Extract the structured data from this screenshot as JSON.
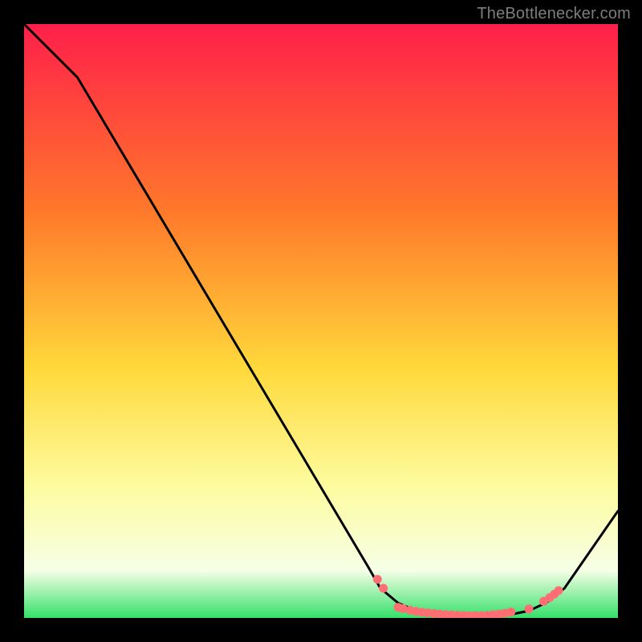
{
  "attribution": "TheBottlenecker.com",
  "colors": {
    "bg_black": "#000000",
    "grad_top": "#ff1f4a",
    "grad_mid1": "#ff7a2a",
    "grad_mid2": "#ffd93b",
    "grad_mid3": "#fdfca0",
    "grad_low": "#f6ffe6",
    "grad_green": "#34e06a",
    "curve": "#000000",
    "marker_fill": "#ff6e72",
    "marker_stroke": "#ff6e72",
    "attr_text": "#7d7d7d"
  },
  "chart_data": {
    "type": "line",
    "title": "",
    "xlabel": "",
    "ylabel": "",
    "xlim": [
      0,
      100
    ],
    "ylim": [
      0,
      100
    ],
    "curve": [
      {
        "x": 0,
        "y": 100
      },
      {
        "x": 9,
        "y": 91
      },
      {
        "x": 58,
        "y": 8.5
      },
      {
        "x": 60,
        "y": 5
      },
      {
        "x": 63,
        "y": 2.5
      },
      {
        "x": 66,
        "y": 1.2
      },
      {
        "x": 70,
        "y": 0.5
      },
      {
        "x": 76,
        "y": 0.3
      },
      {
        "x": 82,
        "y": 0.6
      },
      {
        "x": 85,
        "y": 1.2
      },
      {
        "x": 88,
        "y": 2.6
      },
      {
        "x": 91,
        "y": 5
      },
      {
        "x": 100,
        "y": 18
      }
    ],
    "markers": [
      {
        "x": 59.5,
        "y": 6.5
      },
      {
        "x": 60.5,
        "y": 5.0
      },
      {
        "x": 63.0,
        "y": 1.8
      },
      {
        "x": 63.8,
        "y": 1.6
      },
      {
        "x": 65.0,
        "y": 1.3
      },
      {
        "x": 66.0,
        "y": 1.1
      },
      {
        "x": 67.0,
        "y": 0.95
      },
      {
        "x": 68.0,
        "y": 0.85
      },
      {
        "x": 69.0,
        "y": 0.75
      },
      {
        "x": 70.0,
        "y": 0.65
      },
      {
        "x": 71.0,
        "y": 0.55
      },
      {
        "x": 72.0,
        "y": 0.5
      },
      {
        "x": 73.0,
        "y": 0.45
      },
      {
        "x": 74.0,
        "y": 0.4
      },
      {
        "x": 75.0,
        "y": 0.38
      },
      {
        "x": 76.0,
        "y": 0.37
      },
      {
        "x": 77.0,
        "y": 0.4
      },
      {
        "x": 78.0,
        "y": 0.45
      },
      {
        "x": 79.0,
        "y": 0.55
      },
      {
        "x": 80.0,
        "y": 0.65
      },
      {
        "x": 81.0,
        "y": 0.8
      },
      {
        "x": 82.0,
        "y": 1.0
      },
      {
        "x": 85.0,
        "y": 1.5
      },
      {
        "x": 87.5,
        "y": 2.8
      },
      {
        "x": 88.5,
        "y": 3.4
      },
      {
        "x": 89.3,
        "y": 4.0
      },
      {
        "x": 90.0,
        "y": 4.6
      }
    ]
  }
}
